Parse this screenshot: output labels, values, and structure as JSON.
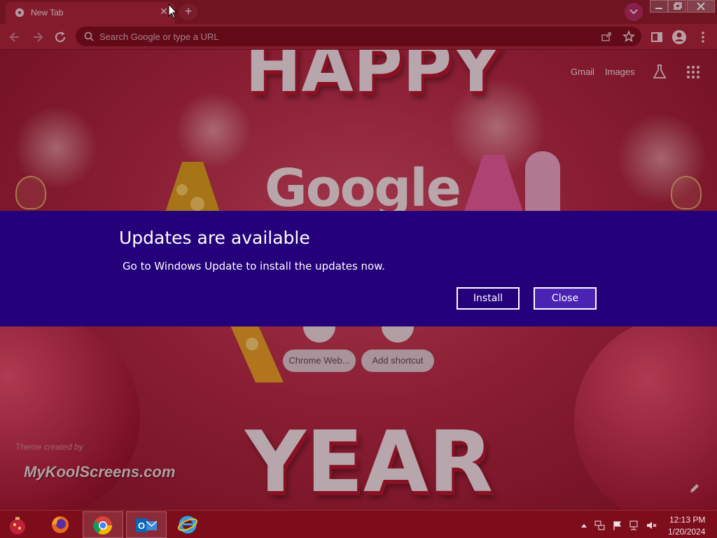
{
  "browser": {
    "tab": {
      "title": "New Tab"
    },
    "omnibox": {
      "placeholder": "Search Google or type a URL"
    }
  },
  "newtab": {
    "header_links": [
      "Gmail",
      "Images"
    ],
    "shortcuts": [
      {
        "label": "Chrome Web..."
      },
      {
        "label": "Add shortcut"
      }
    ],
    "theme_credit": "Theme created by",
    "watermark": "MyKoolScreens.com"
  },
  "update_dialog": {
    "title": "Updates are available",
    "message": "Go to Windows Update to install the updates now.",
    "install_label": "Install",
    "close_label": "Close",
    "background_color": "#24007a"
  },
  "taskbar": {
    "apps": [
      "firefox-icon",
      "chrome-icon",
      "outlook-icon",
      "internet-explorer-icon"
    ],
    "time": "12:13 PM",
    "date": "1/20/2024"
  },
  "colors": {
    "theme": "#a8263a",
    "taskbar": "#7e0d1c"
  }
}
